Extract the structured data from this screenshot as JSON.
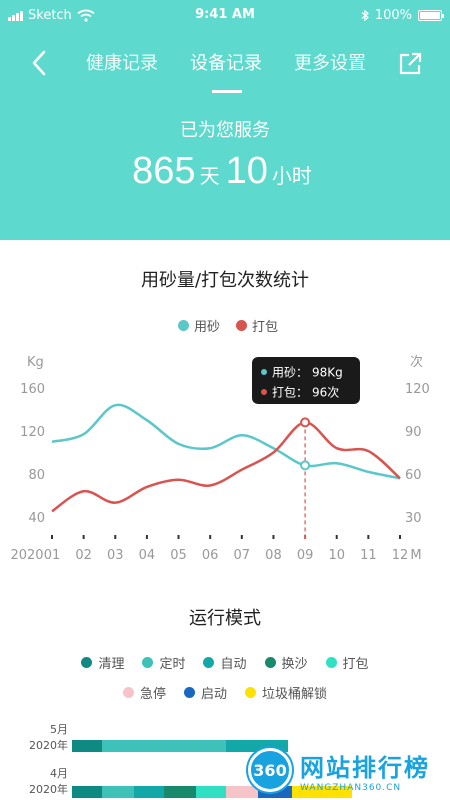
{
  "status": {
    "carrier": "Sketch",
    "time": "9:41 AM",
    "battery": "100%",
    "battery_level": 100
  },
  "nav": {
    "tabs": [
      {
        "label": "健康记录"
      },
      {
        "label": "设备记录",
        "active": true
      },
      {
        "label": "更多设置"
      }
    ]
  },
  "hero": {
    "served_label": "已为您服务",
    "days": "865",
    "days_unit": "天",
    "hours": "10",
    "hours_unit": "小时"
  },
  "colors": {
    "accent": "#5ed9cd",
    "sand": "#5bc7c9",
    "pack": "#d9534f"
  },
  "chart_data": {
    "type": "line",
    "title": "用砂量/打包次数统计",
    "x": [
      "01",
      "02",
      "03",
      "04",
      "05",
      "06",
      "07",
      "08",
      "09",
      "10",
      "11",
      "12"
    ],
    "x_prefix": "2020",
    "x_unit": "M",
    "left_axis": {
      "unit": "Kg",
      "ticks": [
        40,
        80,
        120,
        160
      ],
      "range": [
        40,
        160
      ]
    },
    "right_axis": {
      "unit": "次",
      "ticks": [
        30,
        60,
        90,
        120
      ],
      "range": [
        30,
        120
      ]
    },
    "series": [
      {
        "name": "用砂",
        "axis": "left",
        "color": "#5bc7c9",
        "values": [
          110,
          117,
          144,
          130,
          108,
          104,
          116,
          104,
          88,
          90,
          82,
          76
        ]
      },
      {
        "name": "打包",
        "axis": "right",
        "color": "#d9534f",
        "values": [
          34,
          48,
          40,
          51,
          56,
          52,
          63,
          75,
          96,
          78,
          76,
          57
        ]
      }
    ],
    "highlight_index": 8,
    "tooltip": [
      {
        "label": "用砂：",
        "value": "98Kg"
      },
      {
        "label": "打包：",
        "value": "96次"
      }
    ],
    "legend_position": "top-center",
    "grid": false
  },
  "mode": {
    "title": "运行模式",
    "legend_row1": [
      {
        "label": "清理",
        "color": "#0e8a83"
      },
      {
        "label": "定时",
        "color": "#3ec1b8"
      },
      {
        "label": "自动",
        "color": "#12a8a8"
      },
      {
        "label": "换沙",
        "color": "#168a6a"
      },
      {
        "label": "打包",
        "color": "#2fe0c2"
      }
    ],
    "legend_row2": [
      {
        "label": "急停",
        "color": "#f6c3c8"
      },
      {
        "label": "启动",
        "color": "#1a67c0"
      },
      {
        "label": "垃圾桶解锁",
        "color": "#ffe100"
      }
    ],
    "bars": [
      {
        "month": "5月",
        "year": "2020年"
      },
      {
        "month": "4月",
        "year": "2020年"
      }
    ]
  },
  "watermark": {
    "logo": "360",
    "name": "网站排行榜",
    "domain": "WANGZHAN360.CN"
  }
}
